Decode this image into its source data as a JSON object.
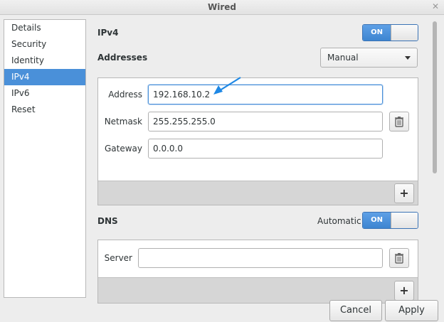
{
  "window": {
    "title": "Wired"
  },
  "sidebar": {
    "items": [
      {
        "label": "Details"
      },
      {
        "label": "Security"
      },
      {
        "label": "Identity"
      },
      {
        "label": "IPv4"
      },
      {
        "label": "IPv6"
      },
      {
        "label": "Reset"
      }
    ],
    "selected": "IPv4"
  },
  "ipv4": {
    "heading": "IPv4",
    "toggle": "ON",
    "addresses_heading": "Addresses",
    "method": "Manual",
    "address_label": "Address",
    "address_value": "192.168.10.2",
    "netmask_label": "Netmask",
    "netmask_value": "255.255.255.0",
    "gateway_label": "Gateway",
    "gateway_value": "0.0.0.0",
    "add_symbol": "+"
  },
  "dns": {
    "heading": "DNS",
    "automatic_label": "Automatic",
    "toggle": "ON",
    "server_label": "Server",
    "server_value": "",
    "add_symbol": "+"
  },
  "footer": {
    "cancel_label": "Cancel",
    "apply_label": "Apply"
  },
  "colors": {
    "accent": "#4a90d9",
    "annotation_arrow": "#1e88e5"
  },
  "icons": {
    "delete": "trash-icon",
    "add": "plus-icon",
    "dropdown": "chevron-down-icon"
  }
}
